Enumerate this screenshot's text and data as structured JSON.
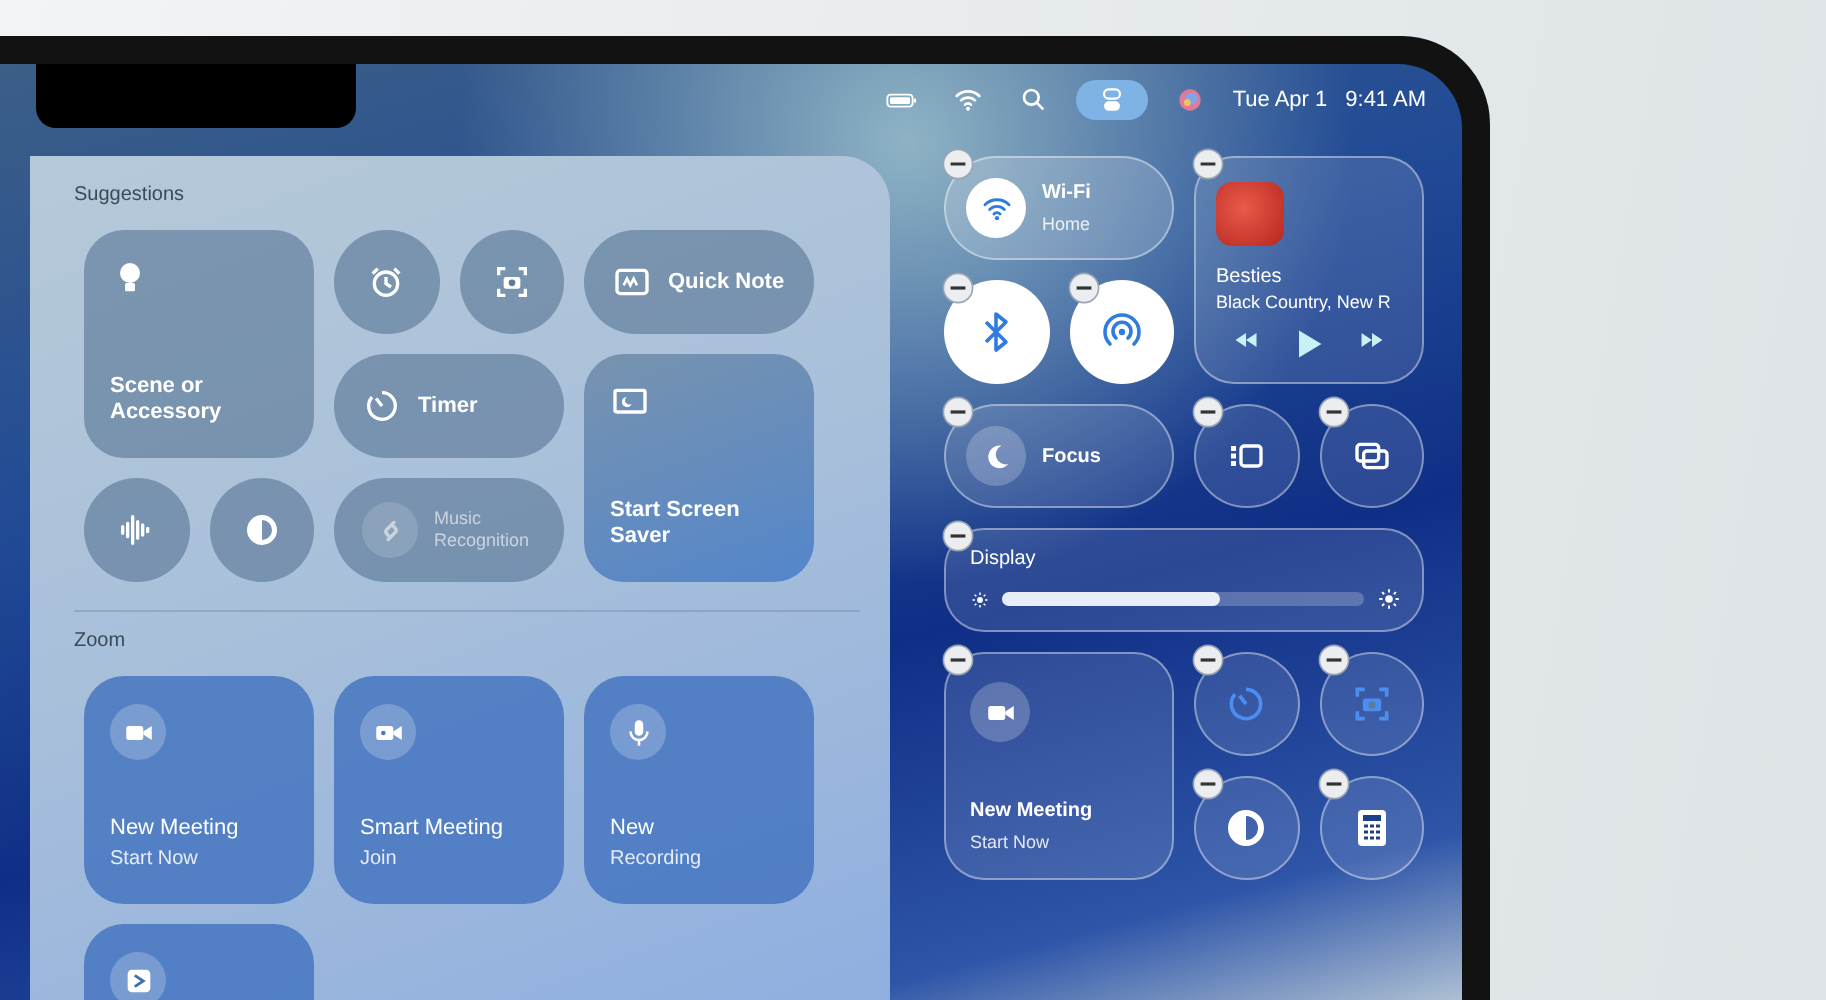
{
  "menu_bar": {
    "items": [
      {
        "kind": "battery",
        "selected": false
      },
      {
        "kind": "wifi",
        "selected": false
      },
      {
        "kind": "search",
        "selected": false
      },
      {
        "kind": "controls",
        "selected": true
      },
      {
        "kind": "siri",
        "selected": false
      }
    ],
    "date": "Tue Apr 1",
    "time": "9:41 AM"
  },
  "gallery": {
    "sections": [
      {
        "title": "Suggestions",
        "tiles": [
          {
            "kind": "bulb",
            "label": "Scene or Accessory",
            "disabled": false
          },
          {
            "kind": "alarm",
            "disabled": false
          },
          {
            "kind": "screenshot",
            "disabled": false
          },
          {
            "kind": "quicknote",
            "label": "Quick Note",
            "disabled": false
          },
          {
            "kind": "timer",
            "label": "Timer",
            "disabled": false
          },
          {
            "kind": "waveform",
            "disabled": false
          },
          {
            "kind": "contrast",
            "disabled": false
          },
          {
            "kind": "shazam",
            "label": "Music Recognition",
            "disabled": true
          },
          {
            "kind": "screensaver",
            "label": "Start Screen Saver",
            "disabled": false
          }
        ]
      },
      {
        "title": "Zoom",
        "tiles": [
          {
            "kind": "video",
            "label": "New Meeting",
            "sublabel": "Start Now",
            "disabled": false
          },
          {
            "kind": "smartvideo",
            "label": "Smart Meeting",
            "sublabel": "Join",
            "disabled": false
          },
          {
            "kind": "mic",
            "label": "New",
            "sublabel": "Recording",
            "disabled": false
          },
          {
            "kind": "zoomapp",
            "disabled": false
          }
        ]
      }
    ]
  },
  "control_center": {
    "tiles": [
      {
        "kind": "wifi",
        "label": "Wi-Fi",
        "sublabel": "Home",
        "on": true
      },
      {
        "kind": "media",
        "title": "Besties",
        "artist": "Black Country, New R"
      },
      {
        "kind": "bluetooth",
        "on": true
      },
      {
        "kind": "airdrop",
        "on": true
      },
      {
        "kind": "moon",
        "label": "Focus",
        "on": false
      },
      {
        "kind": "stagemanager",
        "on": false
      },
      {
        "kind": "mirroring",
        "on": false
      },
      {
        "kind": "display",
        "label": "Display",
        "level": 0.6
      },
      {
        "kind": "video",
        "label": "New Meeting",
        "sublabel": "Start Now"
      },
      {
        "kind": "timer"
      },
      {
        "kind": "screenshot"
      },
      {
        "kind": "contrast"
      },
      {
        "kind": "calculator"
      }
    ]
  }
}
